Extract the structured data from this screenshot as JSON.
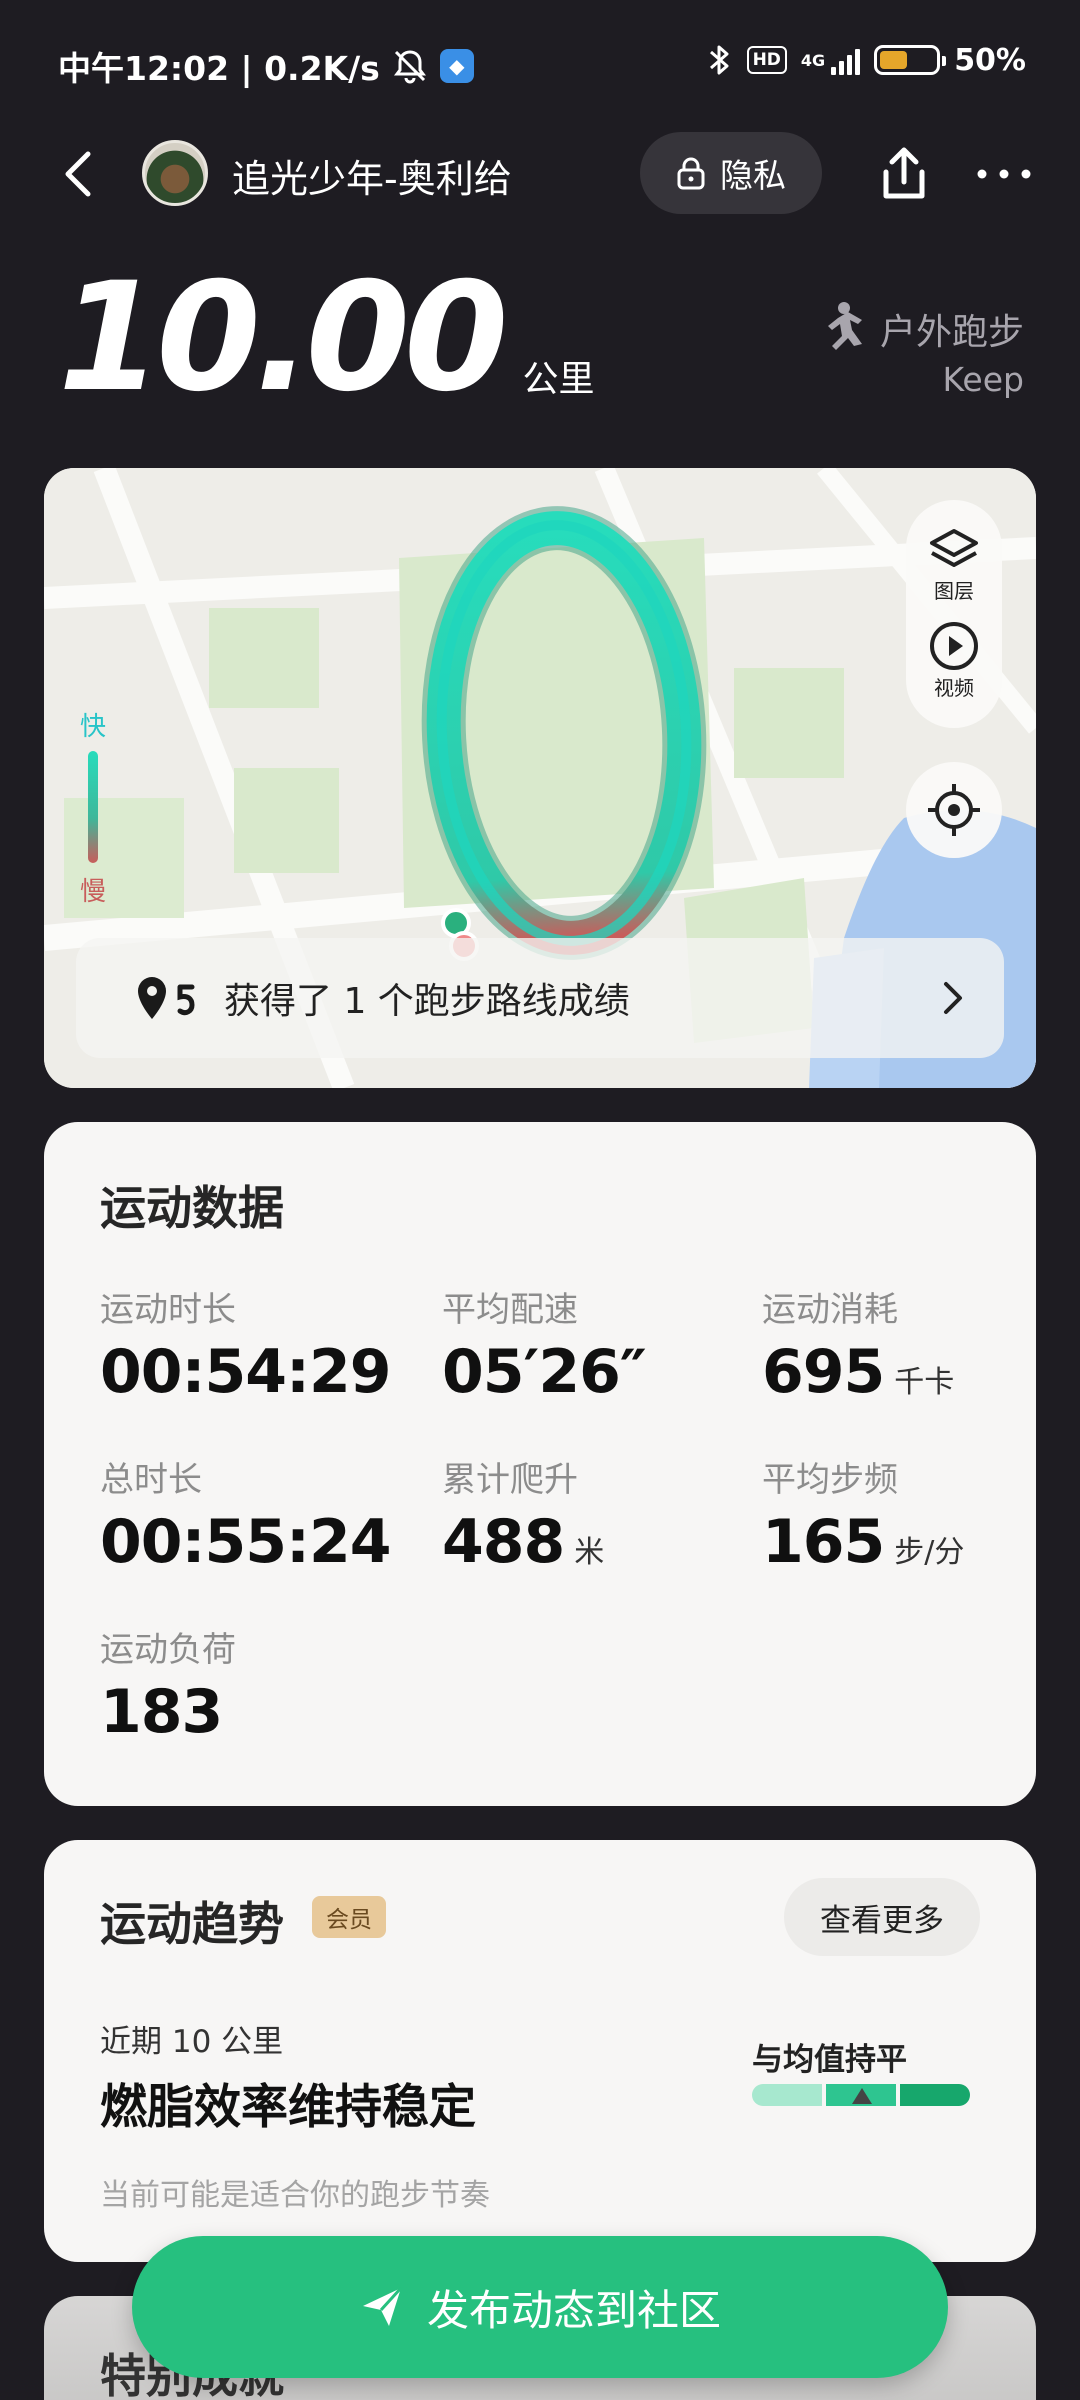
{
  "status_bar": {
    "time_and_speed": "中午12:02 | 0.2K/s",
    "hd": "HD",
    "network": "4G",
    "battery_percent": "50%",
    "battery_level": 0.5
  },
  "header": {
    "username": "追光少年-奥利给",
    "privacy_label": "隐私"
  },
  "summary": {
    "distance": "10.00",
    "distance_unit": "公里",
    "sport_type": "户外跑步",
    "source": "Keep"
  },
  "map": {
    "legend_fast": "快",
    "legend_slow": "慢",
    "layers_label": "图层",
    "video_label": "视频",
    "achievement_text": "获得了 1 个跑步路线成绩",
    "route_fast_color": "#27dcbc",
    "route_slow_color": "#c85d5b"
  },
  "stats": {
    "title": "运动数据",
    "items": [
      {
        "label": "运动时长",
        "value": "00:54:29",
        "unit": ""
      },
      {
        "label": "平均配速",
        "value": "05′26″",
        "unit": ""
      },
      {
        "label": "运动消耗",
        "value": "695",
        "unit": "千卡"
      },
      {
        "label": "总时长",
        "value": "00:55:24",
        "unit": ""
      },
      {
        "label": "累计爬升",
        "value": "488",
        "unit": "米"
      },
      {
        "label": "平均步频",
        "value": "165",
        "unit": "步/分"
      },
      {
        "label": "运动负荷",
        "value": "183",
        "unit": ""
      }
    ]
  },
  "trend": {
    "title": "运动趋势",
    "badge": "会员",
    "more_label": "查看更多",
    "recent_label": "近期 10 公里",
    "headline": "燃脂效率维持稳定",
    "subtext": "当前可能是适合你的跑步节奏",
    "avg_label": "与均值持平"
  },
  "special": {
    "title": "特别成就"
  },
  "publish": {
    "label": "发布动态到社区"
  },
  "colors": {
    "background": "#1e1c22",
    "accent_green": "#26c07f",
    "vip_gold": "#e8c99a"
  }
}
